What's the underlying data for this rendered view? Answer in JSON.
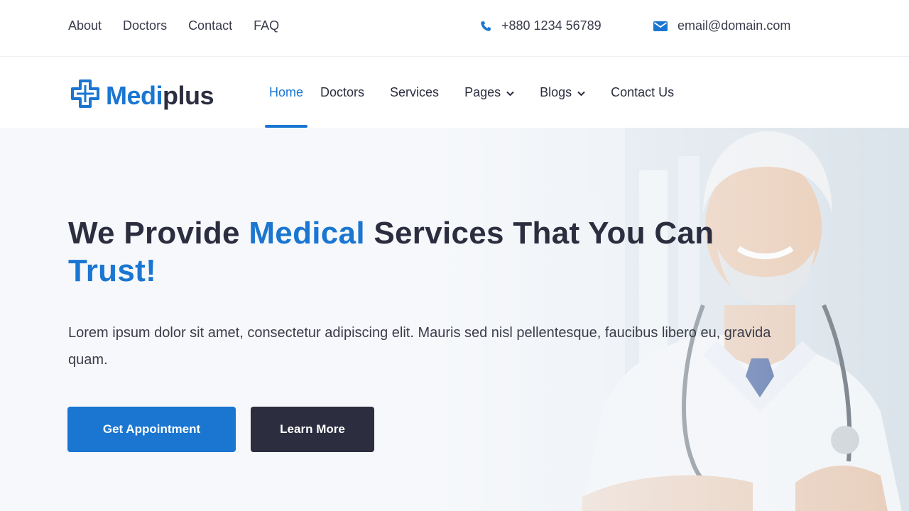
{
  "topbar": {
    "links": [
      "About",
      "Doctors",
      "Contact",
      "FAQ"
    ],
    "phone": "+880 1234 56789",
    "email": "email@domain.com"
  },
  "header": {
    "logo": {
      "part1": "Medi",
      "part2": "plus"
    },
    "nav": [
      {
        "label": "Home",
        "active": true,
        "dropdown": false
      },
      {
        "label": "Doctors",
        "active": false,
        "dropdown": false
      },
      {
        "label": "Services",
        "active": false,
        "dropdown": false
      },
      {
        "label": "Pages",
        "active": false,
        "dropdown": true
      },
      {
        "label": "Blogs",
        "active": false,
        "dropdown": true
      },
      {
        "label": "Contact Us",
        "active": false,
        "dropdown": false
      }
    ]
  },
  "hero": {
    "title_part1": "We Provide ",
    "title_accent1": "Medical",
    "title_part2": " Services That You Can ",
    "title_accent2": "Trust!",
    "text": "Lorem ipsum dolor sit amet, consectetur adipiscing elit. Mauris sed nisl pellentesque, faucibus libero eu, gravida quam.",
    "primary_button": "Get Appointment",
    "secondary_button": "Learn More"
  },
  "colors": {
    "accent": "#1a76d1",
    "dark": "#2c2d3f"
  }
}
